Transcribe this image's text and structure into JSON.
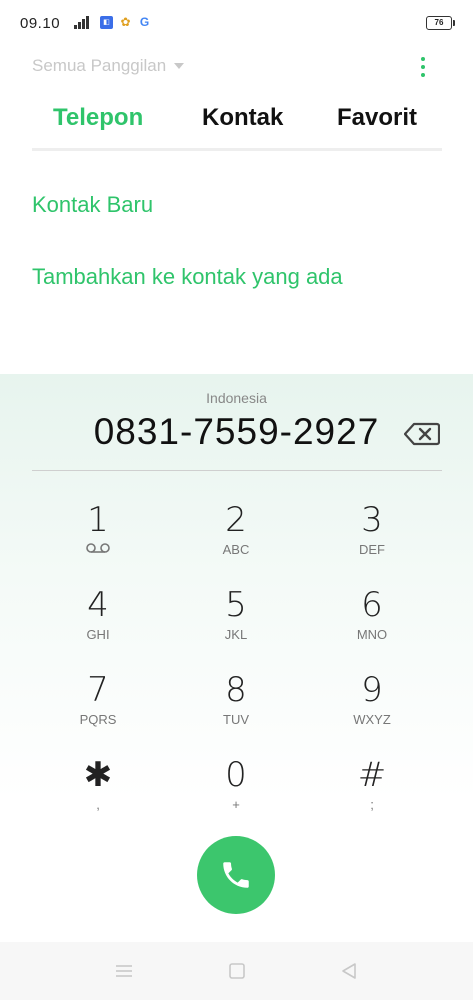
{
  "status_bar": {
    "time": "09.10",
    "network": "4G",
    "battery": "76"
  },
  "header": {
    "filter_label": "Semua Panggilan",
    "more_icon": "more-vertical-icon"
  },
  "tabs": [
    {
      "label": "Telepon",
      "active": true
    },
    {
      "label": "Kontak",
      "active": false
    },
    {
      "label": "Favorit",
      "active": false
    }
  ],
  "actions": {
    "new_contact": "Kontak Baru",
    "add_existing": "Tambahkan ke kontak yang ada"
  },
  "dialer": {
    "region": "Indonesia",
    "number": "0831-7559-2927",
    "keys": [
      {
        "digit": "1",
        "letters": ""
      },
      {
        "digit": "2",
        "letters": "ABC"
      },
      {
        "digit": "3",
        "letters": "DEF"
      },
      {
        "digit": "4",
        "letters": "GHI"
      },
      {
        "digit": "5",
        "letters": "JKL"
      },
      {
        "digit": "6",
        "letters": "MNO"
      },
      {
        "digit": "7",
        "letters": "PQRS"
      },
      {
        "digit": "8",
        "letters": "TUV"
      },
      {
        "digit": "9",
        "letters": "WXYZ"
      },
      {
        "digit": "✱",
        "letters": ","
      },
      {
        "digit": "0",
        "letters": "+"
      },
      {
        "digit": "#",
        "letters": ";"
      }
    ]
  },
  "colors": {
    "accent": "#2fc46b",
    "call_button": "#3cc66d"
  }
}
